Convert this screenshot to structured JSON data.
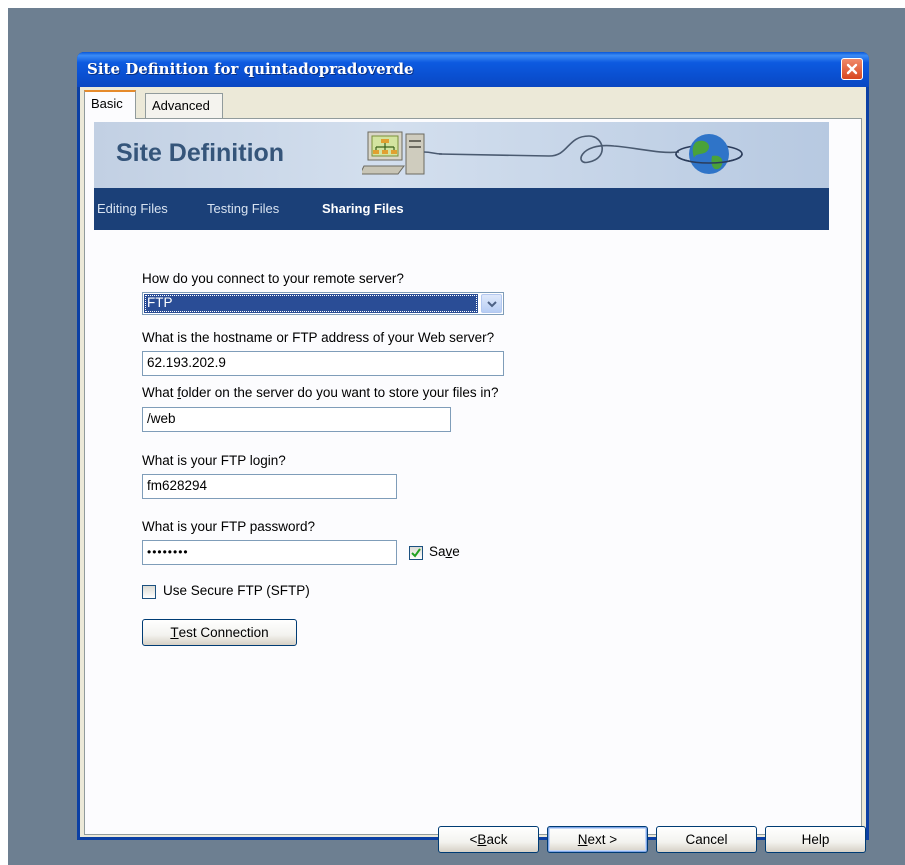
{
  "window": {
    "title": "Site Definition for quintadopradoverde"
  },
  "tabs": [
    {
      "label": "Basic",
      "active": true
    },
    {
      "label": "Advanced",
      "active": false
    }
  ],
  "banner": {
    "title": "Site Definition",
    "icons": [
      "computer-network-icon",
      "globe-icon"
    ]
  },
  "steps": [
    {
      "label": "Editing Files",
      "active": false
    },
    {
      "label": "Testing Files",
      "active": false
    },
    {
      "label": "Sharing Files",
      "active": true
    }
  ],
  "form": {
    "connect_question": "How do you connect to your remote server?",
    "connect_value": "FTP",
    "hostname_question": "What is the hostname or FTP address of your Web server?",
    "hostname_value": "62.193.202.9",
    "folder_question_pre": "What ",
    "folder_question_ul": "f",
    "folder_question_post": "older on the server do you want to store your files in?",
    "folder_value": "/web",
    "login_question": "What is your FTP login?",
    "login_value": "fm628294",
    "password_question": "What is your FTP password?",
    "password_value": "••••••••",
    "save_label_pre": "Sa",
    "save_label_ul": "v",
    "save_label_post": "e",
    "save_checked": true,
    "sftp_label": "Use Secure FTP (SFTP)",
    "sftp_checked": false,
    "test_button_ul": "T",
    "test_button_rest": "est Connection"
  },
  "footer": {
    "back_pre": "< ",
    "back_ul": "B",
    "back_post": "ack",
    "next_ul": "N",
    "next_post": "ext >",
    "cancel": "Cancel",
    "help": "Help"
  },
  "colors": {
    "titlebar": "#0a4fd0",
    "banner_bg": "#c2d0e3",
    "navbar_bg": "#1b4078",
    "selection": "#2a4d96",
    "tab_highlight": "#e68b2c"
  }
}
